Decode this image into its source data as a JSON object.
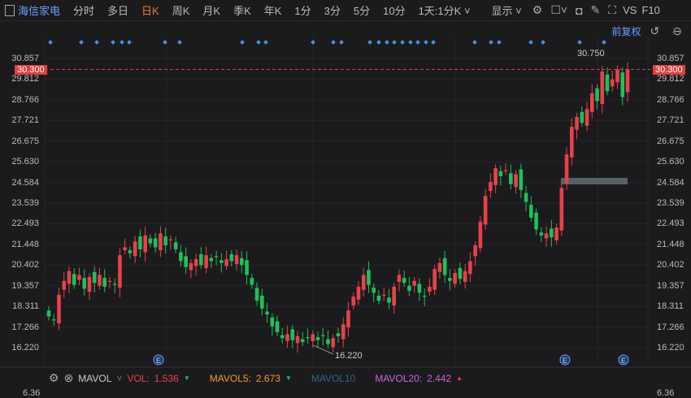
{
  "toolbar": {
    "stock": "海信家电",
    "items": [
      "分时",
      "多日",
      "日K",
      "周K",
      "月K",
      "季K",
      "年K",
      "1分",
      "3分",
      "5分",
      "10分"
    ],
    "active": "日K",
    "range": "1天:1分K",
    "display": "显示",
    "vs": "VS",
    "f10": "F10"
  },
  "sub": {
    "adjust": "前复权"
  },
  "axis": {
    "labels": [
      "30.857",
      "29.812",
      "28.766",
      "27.721",
      "26.675",
      "25.630",
      "24.584",
      "23.539",
      "22.493",
      "21.448",
      "20.402",
      "19.357",
      "18.311",
      "17.266",
      "16.220"
    ],
    "bottom": "6.36"
  },
  "current_price": "30.300",
  "annotations": {
    "high": "30.750",
    "low": "16.220"
  },
  "indicator": {
    "name": "MAVOL",
    "vol_label": "VOL:",
    "vol": "1.536",
    "ma5_label": "MAVOL5:",
    "ma5": "2.673",
    "ma10_label": "MAVOL10",
    "ma20_label": "MAVOL20:",
    "ma20": "2.442"
  },
  "colors": {
    "up": "#e8414a",
    "down": "#1fc05b",
    "bg": "#1b1b1d",
    "accent": "#6aa0ff"
  },
  "chart_data": {
    "type": "candlestick",
    "ylim": [
      16.22,
      30.857
    ],
    "closes": [
      17.8,
      17.6,
      18.9,
      19.6,
      20.1,
      19.4,
      19.9,
      19.2,
      19.8,
      19.5,
      19.9,
      19.3,
      19.6,
      19.4,
      20.9,
      21.3,
      21.0,
      21.6,
      21.2,
      21.9,
      21.5,
      21.3,
      22.0,
      21.4,
      21.7,
      21.2,
      20.6,
      20.3,
      20.5,
      20.7,
      20.4,
      20.9,
      20.6,
      20.8,
      20.5,
      20.7,
      20.6,
      20.9,
      20.4,
      19.9,
      19.4,
      18.6,
      18.2,
      17.9,
      17.3,
      17.0,
      16.7,
      16.9,
      16.6,
      16.8,
      16.5,
      16.7,
      16.9,
      16.6,
      16.8,
      16.4,
      16.7,
      16.8,
      17.4,
      18.1,
      18.8,
      19.3,
      19.9,
      19.4,
      19.0,
      18.6,
      18.9,
      18.5,
      19.3,
      19.9,
      19.5,
      19.1,
      19.6,
      19.0,
      18.8,
      19.3,
      20.2,
      20.5,
      19.9,
      19.6,
      20.0,
      19.7,
      20.1,
      20.6,
      21.4,
      22.6,
      23.9,
      24.6,
      25.3,
      24.9,
      25.2,
      24.5,
      25.0,
      24.2,
      23.6,
      22.8,
      22.2,
      21.9,
      22.0,
      21.8,
      22.3,
      24.3,
      26.0,
      27.4,
      27.9,
      27.6,
      28.3,
      29.1,
      28.7,
      30.2,
      29.2,
      29.8,
      30.3,
      28.9,
      30.3
    ]
  }
}
